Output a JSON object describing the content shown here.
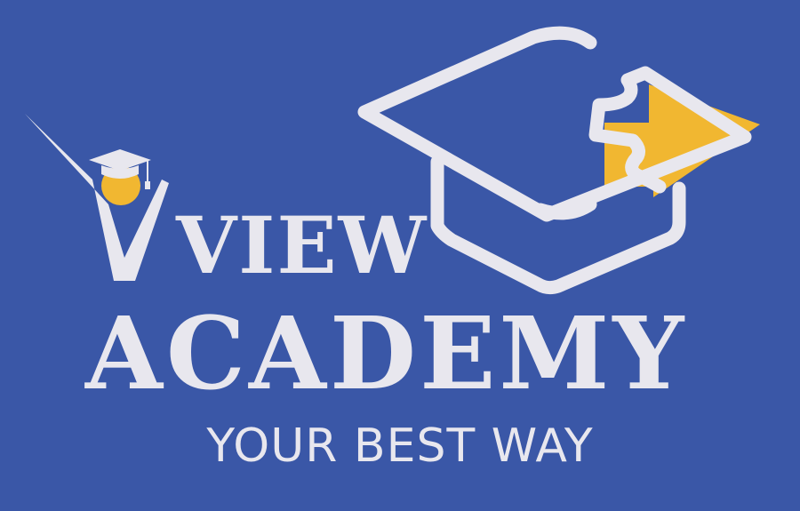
{
  "logo": {
    "title_line1": "VIEW",
    "title_line2": "ACADEMY",
    "tagline": "YOUR BEST WAY"
  },
  "colors": {
    "background": "#3a57a7",
    "text": "#e8e7ee",
    "accent": "#f1b731"
  },
  "icons": {
    "person": "graduate-person-icon",
    "cap": "graduation-cap-icon",
    "arrow": "puzzle-arrow-icon"
  }
}
